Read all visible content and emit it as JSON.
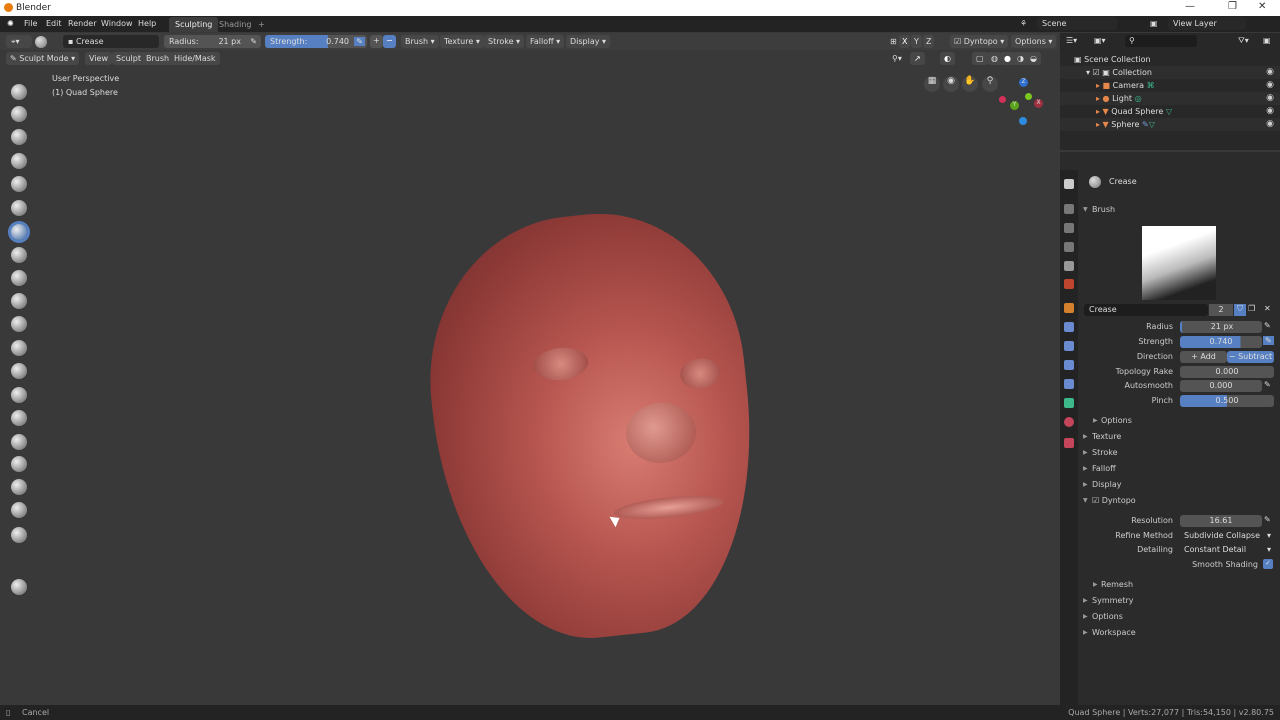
{
  "window": {
    "title": "Blender",
    "min": "—",
    "max": "❐",
    "close": "✕"
  },
  "menu": [
    "File",
    "Edit",
    "Render",
    "Window",
    "Help"
  ],
  "tabs": [
    "Sculpting",
    "Shading",
    "+"
  ],
  "scene": {
    "label": "Scene",
    "view_layer": "View Layer"
  },
  "toolheader": {
    "brush_name": "Crease",
    "radius_label": "Radius:",
    "radius_value": "21 px",
    "strength_label": "Strength:",
    "strength_value": "0.740",
    "plus": "+",
    "minus": "−",
    "menus": [
      "Brush",
      "Texture",
      "Stroke",
      "Falloff",
      "Display"
    ],
    "axes": [
      "X",
      "Y",
      "Z"
    ],
    "dyntopo": "Dyntopo",
    "options": "Options"
  },
  "modeheader": {
    "mode": "Sculpt Mode",
    "menus": [
      "View",
      "Sculpt",
      "Brush",
      "Hide/Mask"
    ]
  },
  "viewport": {
    "perspective": "User Perspective",
    "object": "(1) Quad Sphere",
    "gizmo": {
      "z": "Z",
      "y": "Y",
      "x": "X"
    }
  },
  "tools": [
    "draw",
    "clay",
    "clay-strips",
    "layer",
    "inflate",
    "blob",
    "crease",
    "smooth",
    "flatten",
    "fill",
    "scrape",
    "pinch",
    "grab",
    "snake-hook",
    "thumb",
    "nudge",
    "rotate",
    "mask",
    "simplify",
    "box-mask",
    "annotate"
  ],
  "outliner": {
    "root": "Scene Collection",
    "collection": "Collection",
    "items": [
      "Camera",
      "Light",
      "Quad Sphere",
      "Sphere"
    ]
  },
  "properties": {
    "brush_header": "Crease",
    "brush_section": "Brush",
    "brush_name": "Crease",
    "users": "2",
    "fields": [
      {
        "label": "Radius",
        "value": "21 px"
      },
      {
        "label": "Strength",
        "value": "0.740"
      },
      {
        "label": "Topology Rake",
        "value": "0.000"
      },
      {
        "label": "Autosmooth",
        "value": "0.000"
      },
      {
        "label": "Pinch",
        "value": "0.500"
      }
    ],
    "direction_label": "Direction",
    "direction_add": "+  Add",
    "direction_subtract": "−  Subtract",
    "strength_fraction": 0.74,
    "pinch_fraction": 0.5,
    "options": "Options",
    "sections": [
      "Texture",
      "Stroke",
      "Falloff",
      "Display"
    ],
    "dyntopo": "Dyntopo",
    "resolution_label": "Resolution",
    "resolution": "16.61",
    "refine_label": "Refine Method",
    "refine": "Subdivide Collapse",
    "detailing_label": "Detailing",
    "detailing": "Constant Detail",
    "smooth_shading": "Smooth Shading",
    "after": [
      "Remesh",
      "Symmetry",
      "Options",
      "Workspace"
    ]
  },
  "status": {
    "left": "Cancel",
    "right": "Quad Sphere | Verts:27,077 | Tris:54,150 | v2.80.75"
  }
}
